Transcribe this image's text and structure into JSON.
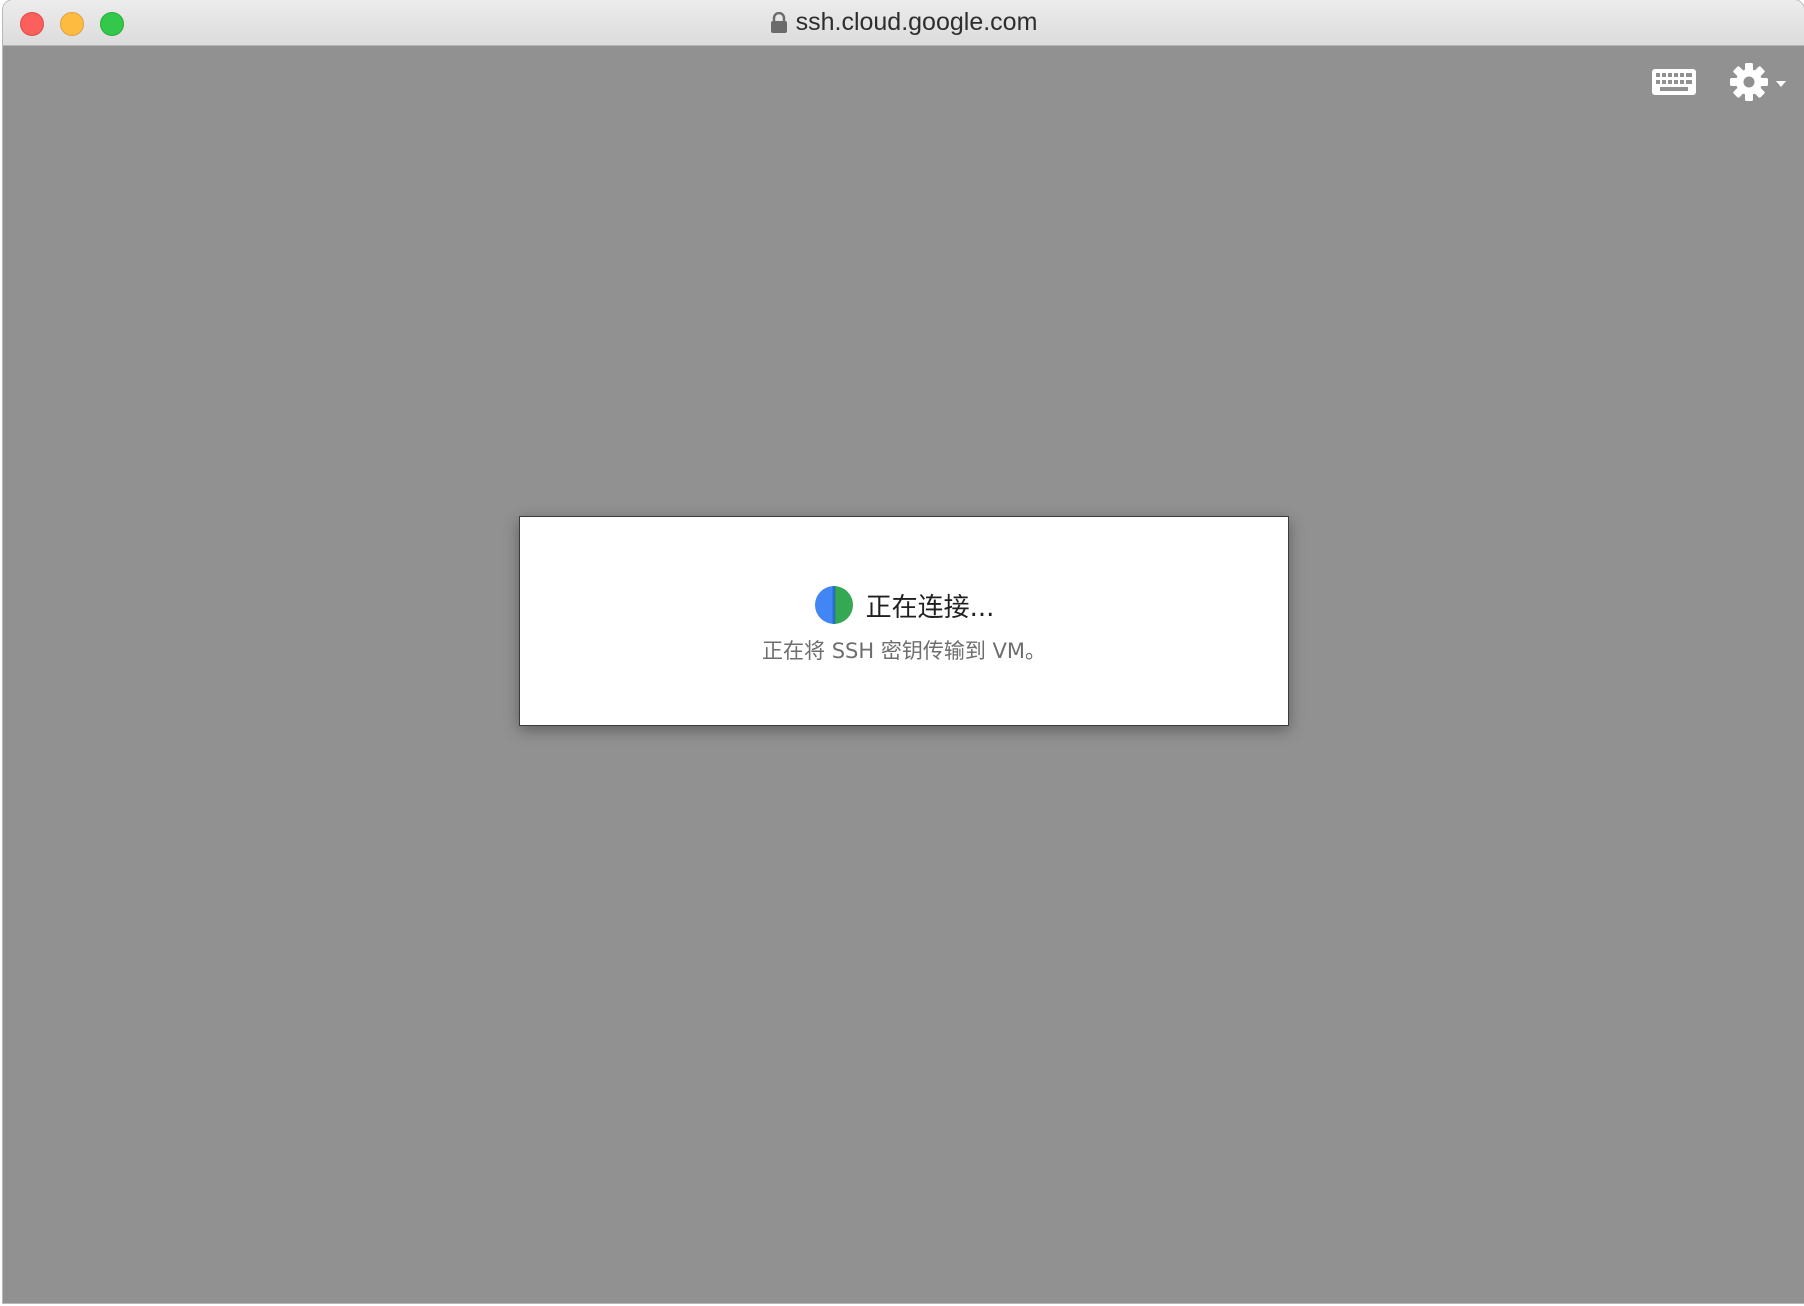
{
  "window": {
    "url": "ssh.cloud.google.com"
  },
  "toolbar": {
    "keyboard_icon": "keyboard-icon",
    "settings_icon": "gear-icon"
  },
  "dialog": {
    "title": "正在连接...",
    "subtitle": "正在将 SSH 密钥传输到 VM。",
    "spinner_colors": [
      "#4285f4",
      "#34a853"
    ]
  },
  "colors": {
    "background": "#919191",
    "dialog_background": "#ffffff"
  }
}
